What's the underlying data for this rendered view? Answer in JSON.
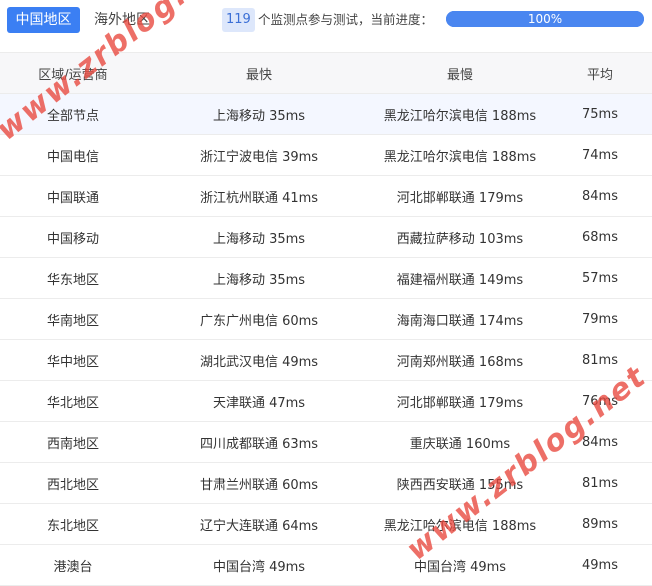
{
  "tabs": {
    "active": "中国地区",
    "other": "海外地区"
  },
  "monitor": {
    "count": "119",
    "text": "个监测点参与测试，当前进度：",
    "progress_percent": 100,
    "progress_label": "100%"
  },
  "table": {
    "headers": [
      "区域/运营商",
      "最快",
      "最慢",
      "平均"
    ],
    "rows": [
      [
        "全部节点",
        "上海移动 35ms",
        "黑龙江哈尔滨电信 188ms",
        "75ms"
      ],
      [
        "中国电信",
        "浙江宁波电信 39ms",
        "黑龙江哈尔滨电信 188ms",
        "74ms"
      ],
      [
        "中国联通",
        "浙江杭州联通 41ms",
        "河北邯郸联通 179ms",
        "84ms"
      ],
      [
        "中国移动",
        "上海移动 35ms",
        "西藏拉萨移动 103ms",
        "68ms"
      ],
      [
        "华东地区",
        "上海移动 35ms",
        "福建福州联通 149ms",
        "57ms"
      ],
      [
        "华南地区",
        "广东广州电信 60ms",
        "海南海口联通 174ms",
        "79ms"
      ],
      [
        "华中地区",
        "湖北武汉电信 49ms",
        "河南郑州联通 168ms",
        "81ms"
      ],
      [
        "华北地区",
        "天津联通 47ms",
        "河北邯郸联通 179ms",
        "76ms"
      ],
      [
        "西南地区",
        "四川成都联通 63ms",
        "重庆联通 160ms",
        "84ms"
      ],
      [
        "西北地区",
        "甘肃兰州联通 60ms",
        "陕西西安联通 155ms",
        "81ms"
      ],
      [
        "东北地区",
        "辽宁大连联通 64ms",
        "黑龙江哈尔滨电信 188ms",
        "89ms"
      ],
      [
        "港澳台",
        "中国台湾 49ms",
        "中国台湾 49ms",
        "49ms"
      ]
    ]
  },
  "watermark": {
    "text": "www.zrblog.net"
  },
  "colors": {
    "accent": "#3b7ff3",
    "watermark": "#e8463c"
  }
}
